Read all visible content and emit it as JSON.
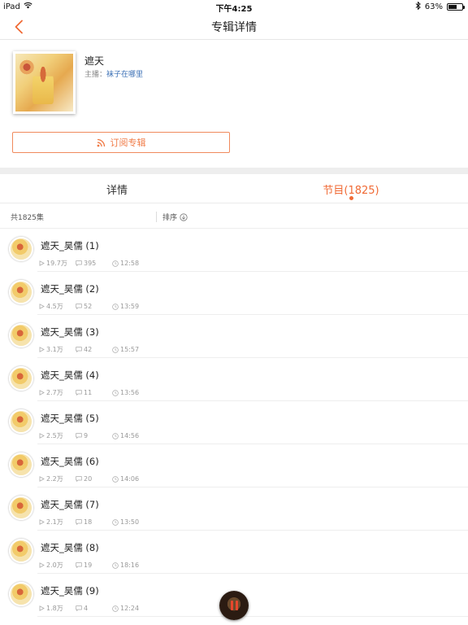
{
  "status": {
    "device": "iPad",
    "time": "下午4:25",
    "battery": "63%",
    "battery_level": 0.63
  },
  "nav": {
    "title": "专辑详情"
  },
  "album": {
    "title": "遮天",
    "host_prefix": "主播：",
    "host_name": "袜子在哪里",
    "subscribe_label": "订阅专辑"
  },
  "tabs": {
    "detail": "详情",
    "programs": "节目(1825)"
  },
  "list_header": {
    "total": "共1825集",
    "sort": "排序"
  },
  "episodes": [
    {
      "title": "遮天_昊儒 (1)",
      "plays": "19.7万",
      "comments": "395",
      "duration": "12:58"
    },
    {
      "title": "遮天_昊儒 (2)",
      "plays": "4.5万",
      "comments": "52",
      "duration": "13:59"
    },
    {
      "title": "遮天_昊儒 (3)",
      "plays": "3.1万",
      "comments": "42",
      "duration": "15:57"
    },
    {
      "title": "遮天_昊儒 (4)",
      "plays": "2.7万",
      "comments": "11",
      "duration": "13:56"
    },
    {
      "title": "遮天_昊儒 (5)",
      "plays": "2.5万",
      "comments": "9",
      "duration": "14:56"
    },
    {
      "title": "遮天_昊儒 (6)",
      "plays": "2.2万",
      "comments": "20",
      "duration": "14:06"
    },
    {
      "title": "遮天_昊儒 (7)",
      "plays": "2.1万",
      "comments": "18",
      "duration": "13:50"
    },
    {
      "title": "遮天_昊儒 (8)",
      "plays": "2.0万",
      "comments": "19",
      "duration": "18:16"
    },
    {
      "title": "遮天_昊儒 (9)",
      "plays": "1.8万",
      "comments": "4",
      "duration": "12:24"
    }
  ],
  "colors": {
    "accent": "#f06a35",
    "link": "#3a6fb5",
    "muted": "#999999",
    "band": "#eeeeee"
  },
  "icons": [
    "wifi-icon",
    "bluetooth-icon",
    "battery-icon",
    "back-chevron-icon",
    "rss-icon",
    "sort-icon",
    "play-count-icon",
    "comment-icon",
    "duration-icon",
    "pause-icon"
  ]
}
